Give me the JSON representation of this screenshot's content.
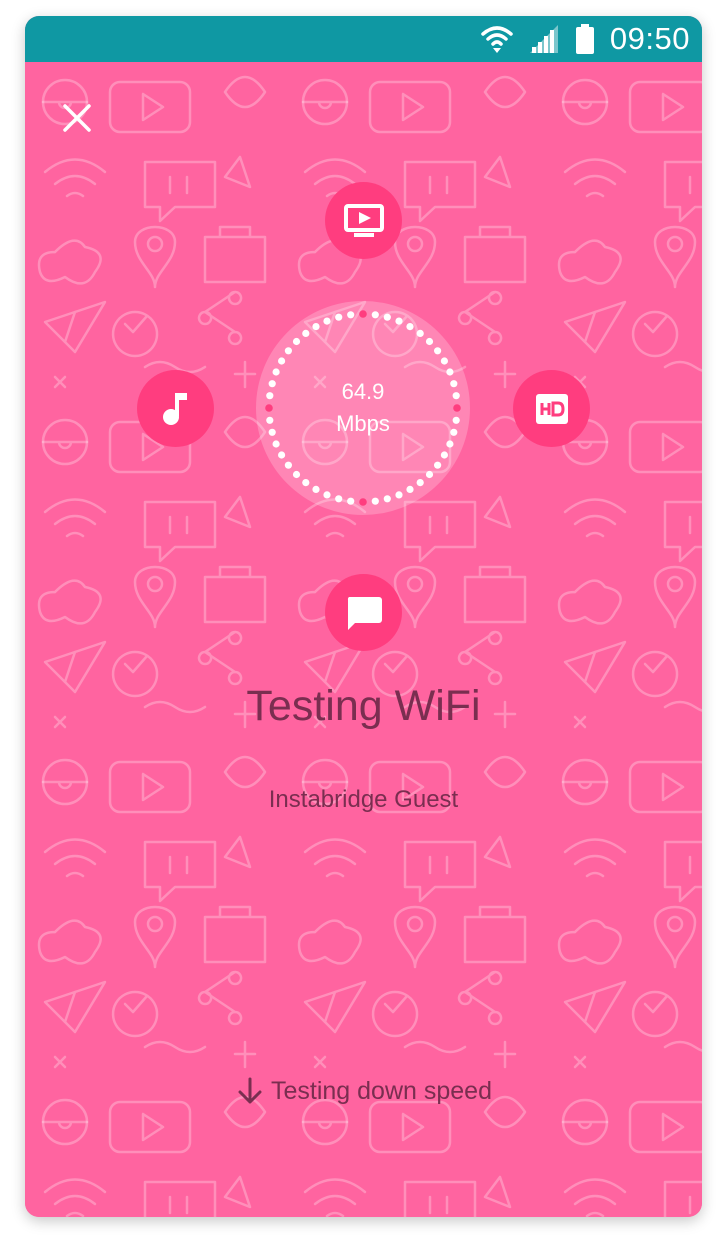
{
  "status_bar": {
    "time": "09:50",
    "icons": [
      "wifi-icon",
      "signal-icon",
      "battery-icon"
    ],
    "background": "#0f98a3"
  },
  "screen": {
    "background": "#ff64a0",
    "accent": "#ff3d7f",
    "text_color": "#7a2e50"
  },
  "controls": {
    "close_icon": "close-icon"
  },
  "gauge": {
    "value": "64.9",
    "unit": "Mbps"
  },
  "feature_icons": {
    "top": "video-icon",
    "left": "music-note-icon",
    "right": "hd-icon",
    "bottom": "chat-icon"
  },
  "main": {
    "title": "Testing WiFi",
    "network_name": "Instabridge Guest",
    "status": "Testing down speed",
    "status_icon": "arrow-down-icon"
  }
}
